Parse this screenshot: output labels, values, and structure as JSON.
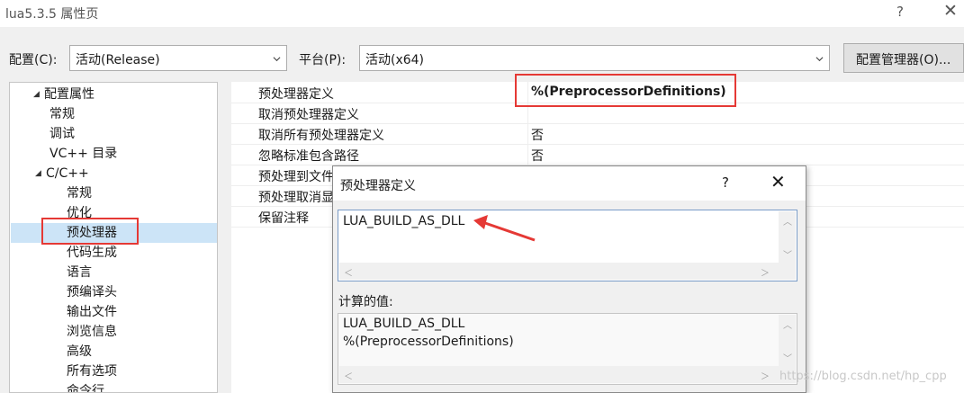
{
  "window": {
    "title": "lua5.3.5 属性页",
    "help_glyph": "?",
    "close_glyph": "✕"
  },
  "toolbar": {
    "config_label": "配置(C):",
    "config_value": "活动(Release)",
    "platform_label": "平台(P):",
    "platform_value": "活动(x64)",
    "manager_button": "配置管理器(O)..."
  },
  "tree": {
    "items": [
      {
        "label": "配置属性",
        "expanded": true
      },
      {
        "label": "常规"
      },
      {
        "label": "调试"
      },
      {
        "label": "VC++ 目录"
      },
      {
        "label": "C/C++",
        "expanded": true
      },
      {
        "label": "常规"
      },
      {
        "label": "优化"
      },
      {
        "label": "预处理器",
        "selected": true
      },
      {
        "label": "代码生成"
      },
      {
        "label": "语言"
      },
      {
        "label": "预编译头"
      },
      {
        "label": "输出文件"
      },
      {
        "label": "浏览信息"
      },
      {
        "label": "高级"
      },
      {
        "label": "所有选项"
      },
      {
        "label": "命令行"
      }
    ],
    "expand_glyph": "◢"
  },
  "properties": {
    "rows": [
      {
        "name": "预处理器定义",
        "value": "%(PreprocessorDefinitions)"
      },
      {
        "name": "取消预处理器定义",
        "value": ""
      },
      {
        "name": "取消所有预处理器定义",
        "value": "否"
      },
      {
        "name": "忽略标准包含路径",
        "value": "否"
      },
      {
        "name": "预处理到文件",
        "value": ""
      },
      {
        "name": "预处理取消显",
        "value": ""
      },
      {
        "name": "保留注释",
        "value": ""
      }
    ]
  },
  "dialog": {
    "title": "预处理器定义",
    "help_glyph": "?",
    "close_glyph": "✕",
    "input_value": "LUA_BUILD_AS_DLL",
    "computed_label": "计算的值:",
    "computed_lines": [
      "LUA_BUILD_AS_DLL",
      "%(PreprocessorDefinitions)"
    ]
  },
  "watermark": "https://blog.csdn.net/hp_cpp",
  "colors": {
    "highlight_red": "#e53935",
    "selection": "#cce4f7"
  }
}
